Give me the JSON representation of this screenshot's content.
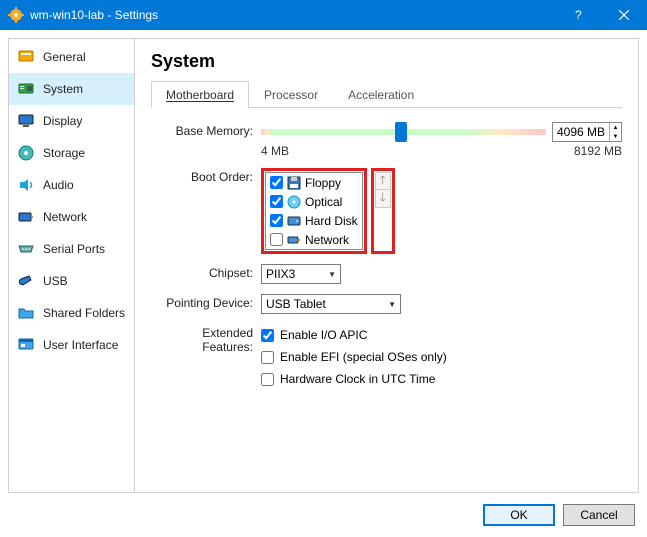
{
  "window": {
    "title": "wm-win10-lab - Settings"
  },
  "sidebar": {
    "items": [
      {
        "label": "General"
      },
      {
        "label": "System"
      },
      {
        "label": "Display"
      },
      {
        "label": "Storage"
      },
      {
        "label": "Audio"
      },
      {
        "label": "Network"
      },
      {
        "label": "Serial Ports"
      },
      {
        "label": "USB"
      },
      {
        "label": "Shared Folders"
      },
      {
        "label": "User Interface"
      }
    ]
  },
  "main": {
    "heading": "System",
    "tabs": {
      "motherboard": "Motherboard",
      "processor": "Processor",
      "acceleration": "Acceleration"
    },
    "base_memory": {
      "label": "Base Memory:",
      "value": "4096 MB",
      "min_label": "4 MB",
      "max_label": "8192 MB"
    },
    "boot_order": {
      "label": "Boot Order:",
      "items": [
        {
          "label": "Floppy",
          "checked": true
        },
        {
          "label": "Optical",
          "checked": true
        },
        {
          "label": "Hard Disk",
          "checked": true
        },
        {
          "label": "Network",
          "checked": false
        }
      ]
    },
    "chipset": {
      "label": "Chipset:",
      "value": "PIIX3"
    },
    "pointing": {
      "label": "Pointing Device:",
      "value": "USB Tablet"
    },
    "extended": {
      "label": "Extended Features:",
      "io_apic": {
        "label": "Enable I/O APIC",
        "checked": true
      },
      "efi": {
        "label": "Enable EFI (special OSes only)",
        "checked": false
      },
      "utc": {
        "label": "Hardware Clock in UTC Time",
        "checked": false
      }
    }
  },
  "footer": {
    "ok": "OK",
    "cancel": "Cancel"
  }
}
